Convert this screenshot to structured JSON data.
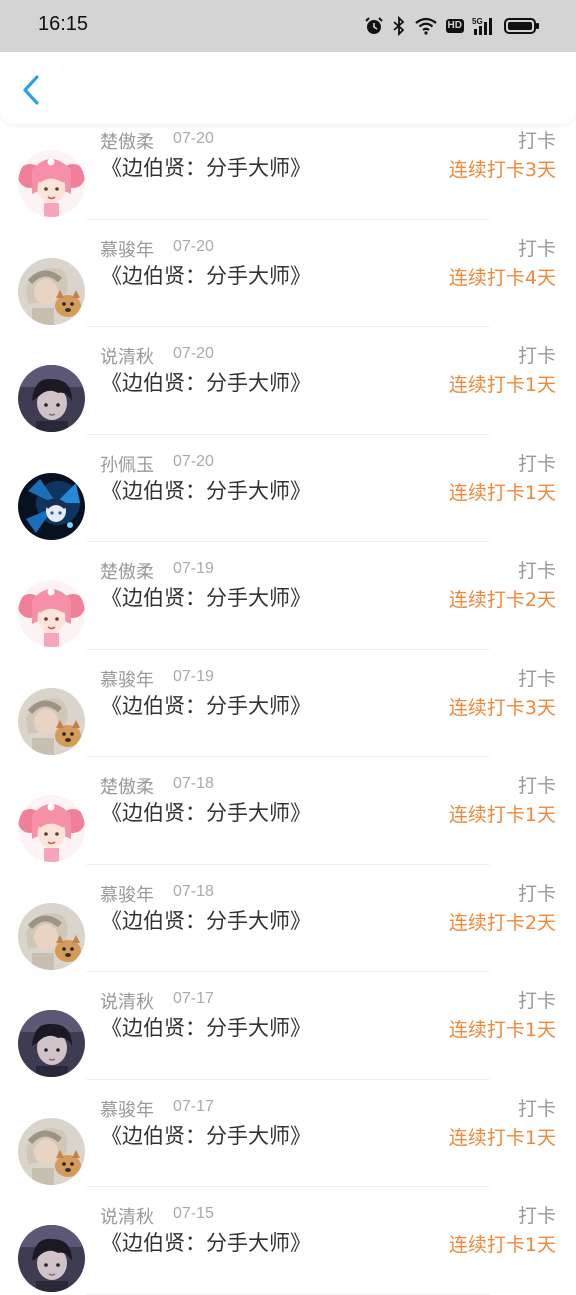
{
  "status_bar": {
    "time": "16:15",
    "icons": [
      "alarm-icon",
      "bluetooth-icon",
      "wifi-icon",
      "hd-badge",
      "5g-signal-icon",
      "battery-icon"
    ],
    "hd_label": "HD"
  },
  "nav": {
    "back_icon": "chevron-left-icon",
    "accent_color": "#2aa3df"
  },
  "colors": {
    "streak": "#f0883a",
    "meta": "#999999",
    "title": "#333333"
  },
  "checkins": [
    {
      "user": "楚傲柔",
      "date": "07-20",
      "book": "《边伯贤：分手大师》",
      "action": "打卡",
      "streak": "连续打卡3天",
      "avatar": "anime-girl"
    },
    {
      "user": "慕骏年",
      "date": "07-20",
      "book": "《边伯贤：分手大师》",
      "action": "打卡",
      "streak": "连续打卡4天",
      "avatar": "girl-dog"
    },
    {
      "user": "说清秋",
      "date": "07-20",
      "book": "《边伯贤：分手大师》",
      "action": "打卡",
      "streak": "连续打卡1天",
      "avatar": "dark-boy"
    },
    {
      "user": "孙佩玉",
      "date": "07-20",
      "book": "《边伯贤：分手大师》",
      "action": "打卡",
      "streak": "连续打卡1天",
      "avatar": "blue-anime"
    },
    {
      "user": "楚傲柔",
      "date": "07-19",
      "book": "《边伯贤：分手大师》",
      "action": "打卡",
      "streak": "连续打卡2天",
      "avatar": "anime-girl"
    },
    {
      "user": "慕骏年",
      "date": "07-19",
      "book": "《边伯贤：分手大师》",
      "action": "打卡",
      "streak": "连续打卡3天",
      "avatar": "girl-dog"
    },
    {
      "user": "楚傲柔",
      "date": "07-18",
      "book": "《边伯贤：分手大师》",
      "action": "打卡",
      "streak": "连续打卡1天",
      "avatar": "anime-girl"
    },
    {
      "user": "慕骏年",
      "date": "07-18",
      "book": "《边伯贤：分手大师》",
      "action": "打卡",
      "streak": "连续打卡2天",
      "avatar": "girl-dog"
    },
    {
      "user": "说清秋",
      "date": "07-17",
      "book": "《边伯贤：分手大师》",
      "action": "打卡",
      "streak": "连续打卡1天",
      "avatar": "dark-boy"
    },
    {
      "user": "慕骏年",
      "date": "07-17",
      "book": "《边伯贤：分手大师》",
      "action": "打卡",
      "streak": "连续打卡1天",
      "avatar": "girl-dog"
    },
    {
      "user": "说清秋",
      "date": "07-15",
      "book": "《边伯贤：分手大师》",
      "action": "打卡",
      "streak": "连续打卡1天",
      "avatar": "dark-boy"
    }
  ]
}
